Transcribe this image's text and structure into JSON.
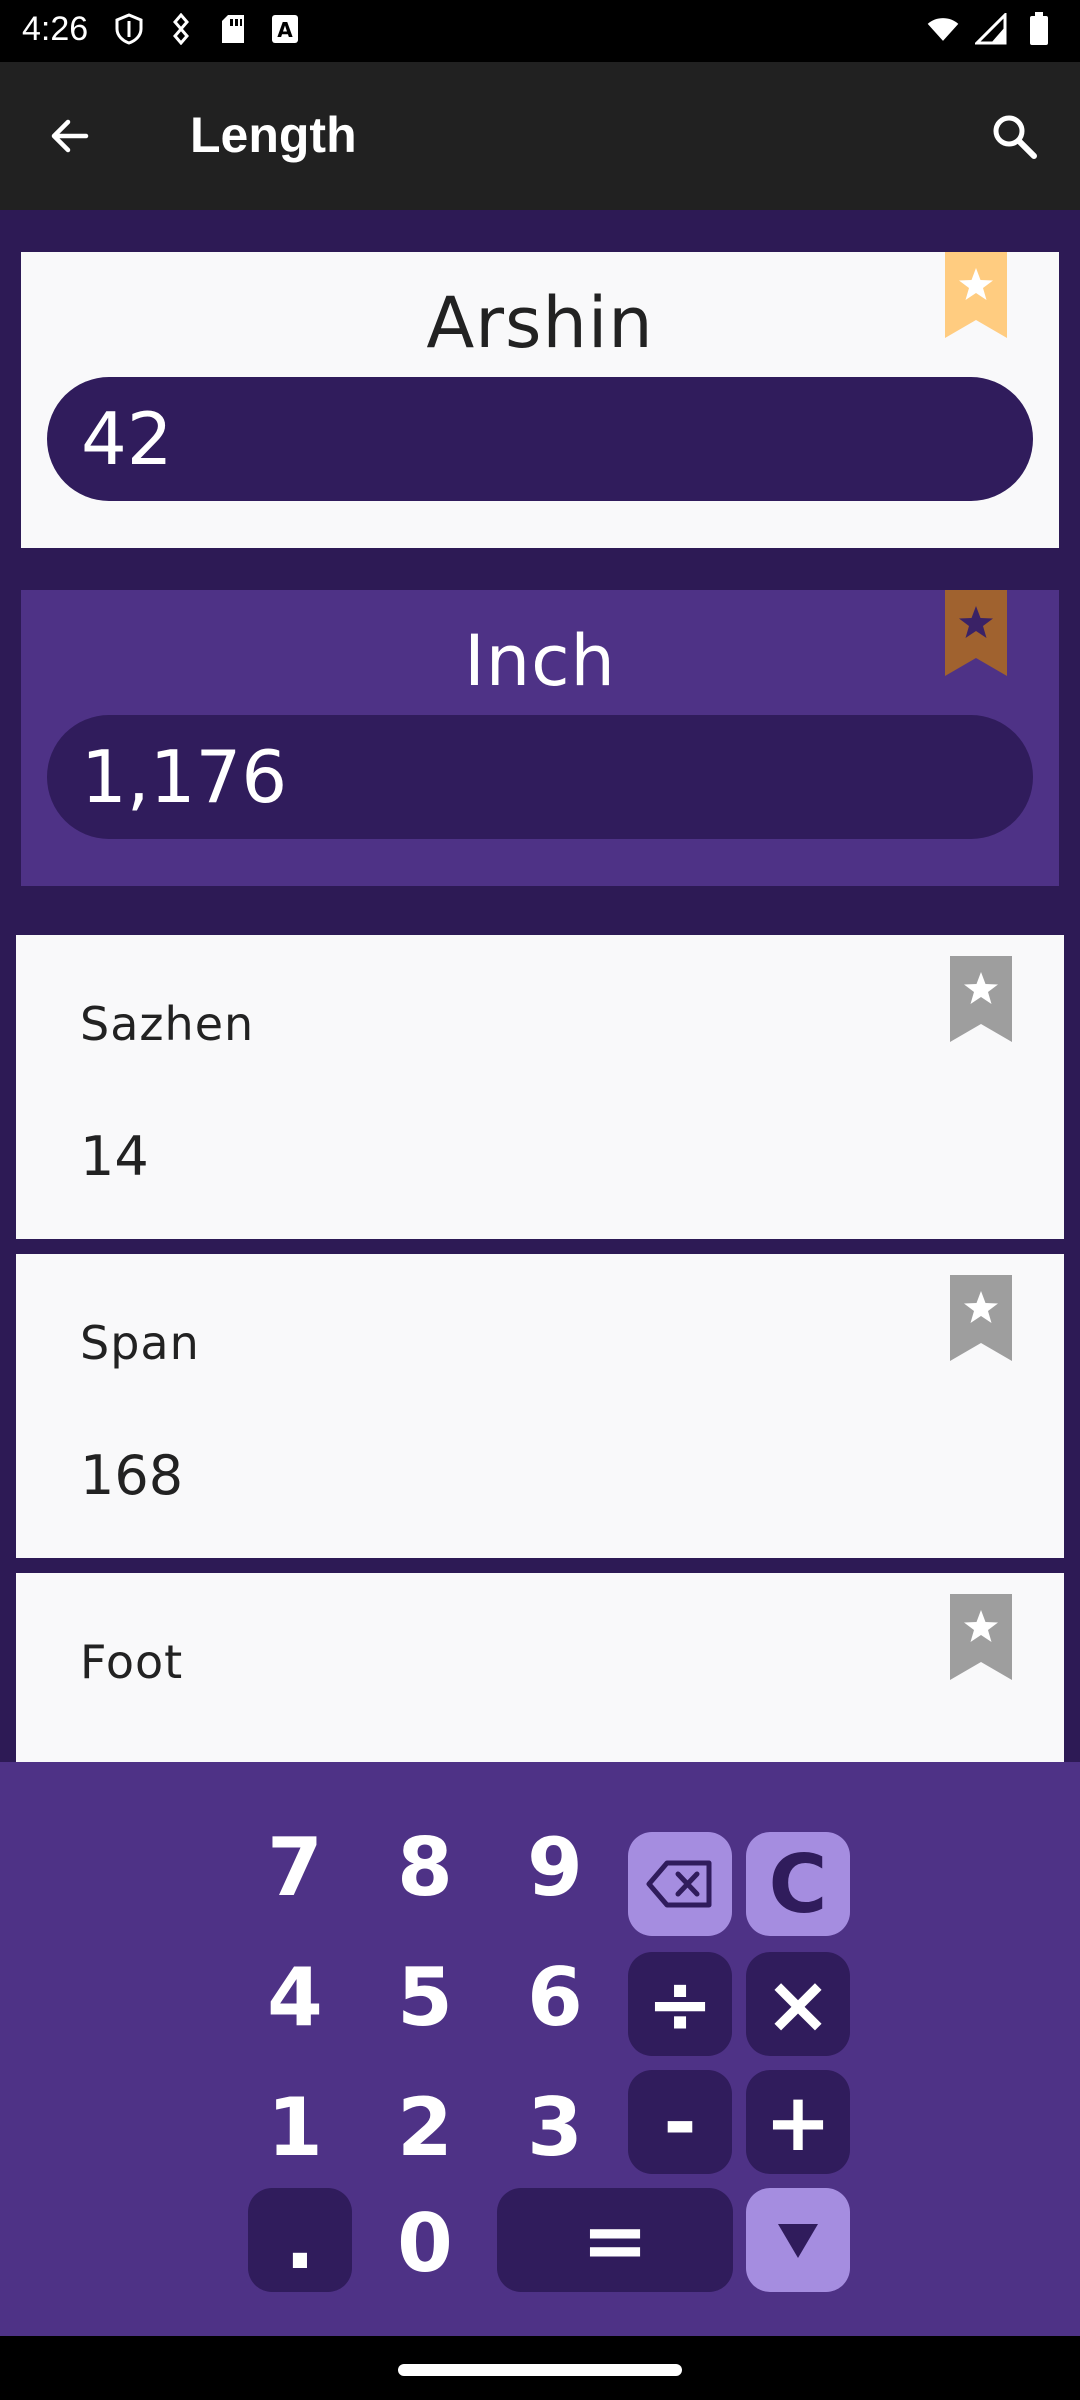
{
  "status_bar": {
    "time": "4:26"
  },
  "app_bar": {
    "title": "Length"
  },
  "converter": {
    "from": {
      "unit": "Arshin",
      "value": "42"
    },
    "to": {
      "unit": "Inch",
      "value": "1,176"
    }
  },
  "units_list": [
    {
      "name": "Sazhen",
      "value": "14"
    },
    {
      "name": "Span",
      "value": "168"
    },
    {
      "name": "Foot",
      "value": ""
    }
  ],
  "keypad": {
    "digits": {
      "k7": "7",
      "k8": "8",
      "k9": "9",
      "k4": "4",
      "k5": "5",
      "k6": "6",
      "k1": "1",
      "k2": "2",
      "k3": "3",
      "k0": "0"
    },
    "dot": ".",
    "clear": "C",
    "divide": "÷",
    "multiply": "×",
    "minus": "-",
    "plus": "+",
    "equals": "="
  },
  "colors": {
    "background": "#2d1a55",
    "card_selected": "#4e3286",
    "pill": "#301c5c",
    "key_light": "#a58de0",
    "bookmark_favorite": "#ffcc80",
    "bookmark_to": "#a0622f",
    "bookmark_default": "#9e9e9e"
  }
}
